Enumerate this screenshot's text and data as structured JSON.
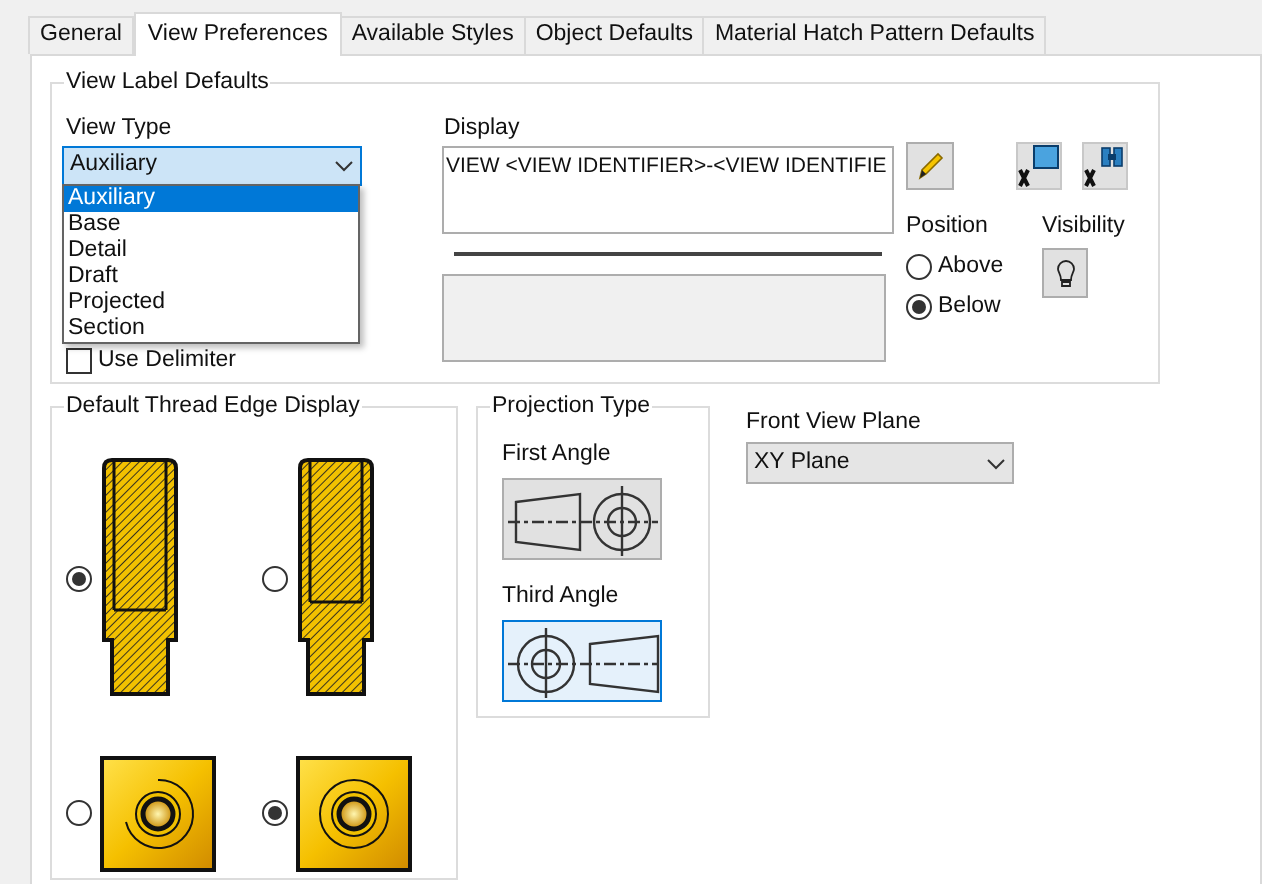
{
  "tabs": [
    {
      "label": "General",
      "selected": false
    },
    {
      "label": "View Preferences",
      "selected": true
    },
    {
      "label": "Available Styles",
      "selected": false
    },
    {
      "label": "Object Defaults",
      "selected": false
    },
    {
      "label": "Material Hatch Pattern Defaults",
      "selected": false
    }
  ],
  "view_label_defaults": {
    "title": "View Label Defaults",
    "view_type": {
      "label": "View Type",
      "value": "Auxiliary",
      "expanded": true,
      "options": [
        {
          "label": "Auxiliary",
          "selected": true
        },
        {
          "label": "Base",
          "selected": false
        },
        {
          "label": "Detail",
          "selected": false
        },
        {
          "label": "Draft",
          "selected": false
        },
        {
          "label": "Projected",
          "selected": false
        },
        {
          "label": "Section",
          "selected": false
        }
      ]
    },
    "use_delimiter": {
      "label": "Use Delimiter",
      "checked": false
    },
    "display": {
      "label": "Display",
      "value": "VIEW <VIEW IDENTIFIER>-<VIEW IDENTIFIE"
    },
    "position": {
      "label": "Position",
      "options": [
        {
          "label": "Above",
          "selected": false
        },
        {
          "label": "Below",
          "selected": true
        }
      ]
    },
    "visibility": {
      "label": "Visibility"
    }
  },
  "thread_edge_display": {
    "title": "Default Thread Edge Display",
    "options": [
      {
        "kind": "side",
        "selected": true
      },
      {
        "kind": "side",
        "selected": false
      },
      {
        "kind": "end",
        "selected": false
      },
      {
        "kind": "end",
        "selected": true
      }
    ]
  },
  "projection_type": {
    "title": "Projection Type",
    "options": [
      {
        "label": "First Angle",
        "kind": "first",
        "selected": false
      },
      {
        "label": "Third Angle",
        "kind": "third",
        "selected": true
      }
    ]
  },
  "front_view_plane": {
    "label": "Front View Plane",
    "value": "XY Plane"
  }
}
